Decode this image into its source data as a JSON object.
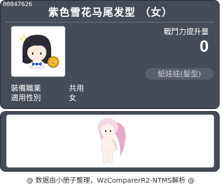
{
  "item": {
    "id": "00047626",
    "title": "紫色雪花马尾发型 （女）",
    "icon": "hair-item-icon",
    "stat_label": "戰鬥力提升量",
    "stat_value": "0",
    "category": "紙娃娃(髮型)",
    "info": [
      {
        "key": "裝備職業",
        "value": "共用"
      },
      {
        "key": "適用性別",
        "value": "女"
      }
    ]
  },
  "preview": {
    "icon": "character-preview-icon"
  },
  "footer": {
    "credit": "@ 数据由小册子整理，WzComparerR2-NTMS解析 @"
  },
  "colors": {
    "panel_bg": "#454b57",
    "text": "#ffffff",
    "muted": "#c9ccd2"
  }
}
